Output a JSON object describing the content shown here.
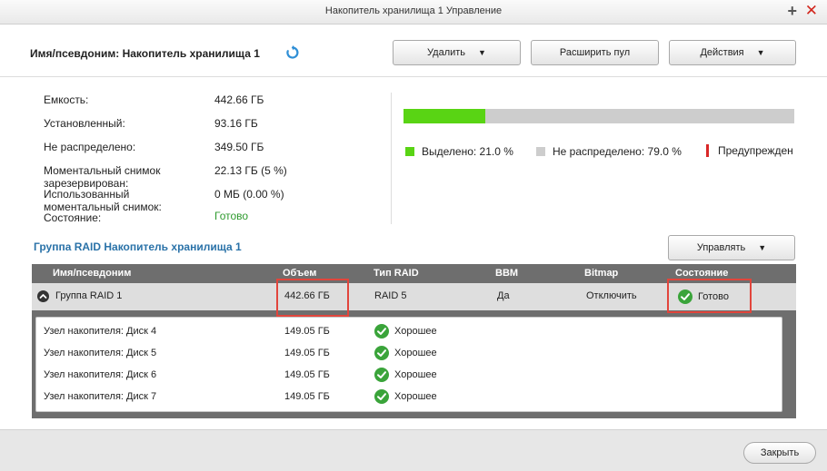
{
  "window": {
    "title": "Накопитель хранилища 1 Управление"
  },
  "header": {
    "alias": "Имя/псевдоним: Накопитель хранилища 1",
    "buttons": {
      "delete": "Удалить",
      "expand": "Расширить пул",
      "actions": "Действия"
    }
  },
  "info": [
    {
      "label": "Емкость:",
      "value": "442.66 ГБ"
    },
    {
      "label": "Установленный:",
      "value": "93.16 ГБ"
    },
    {
      "label": "Не распределено:",
      "value": "349.50 ГБ"
    },
    {
      "label": "Моментальный снимок зарезервирован:",
      "value": "22.13 ГБ (5 %)"
    },
    {
      "label": "Использованный моментальный снимок:",
      "value": "0 МБ (0.00 %)"
    },
    {
      "label": "Состояние:",
      "value": "Готово"
    }
  ],
  "usage": {
    "allocated_percent": 21.0,
    "legend": {
      "allocated": "Выделено: 21.0 %",
      "unallocated": "Не распределено: 79.0 %",
      "warning": "Предупрежден"
    },
    "colors": {
      "allocated": "#59d414",
      "unallocated": "#cdcdcd",
      "warning": "#d92727"
    }
  },
  "raid": {
    "title": "Группа RAID Накопитель хранилища 1",
    "manage_button": "Управлять",
    "columns": {
      "name": "Имя/псевдоним",
      "capacity": "Объем",
      "raid_type": "Тип RAID",
      "bbm": "BBM",
      "bitmap": "Bitmap",
      "status": "Состояние"
    },
    "group": {
      "name": "Группа RAID 1",
      "capacity": "442.66 ГБ",
      "raid_type": "RAID 5",
      "bbm": "Да",
      "bitmap": "Отключить",
      "status": "Готово"
    },
    "disks": [
      {
        "name": "Узел накопителя: Диск 4",
        "capacity": "149.05 ГБ",
        "status": "Хорошее"
      },
      {
        "name": "Узел накопителя: Диск 5",
        "capacity": "149.05 ГБ",
        "status": "Хорошее"
      },
      {
        "name": "Узел накопителя: Диск 6",
        "capacity": "149.05 ГБ",
        "status": "Хорошее"
      },
      {
        "name": "Узел накопителя: Диск 7",
        "capacity": "149.05 ГБ",
        "status": "Хорошее"
      }
    ]
  },
  "footer": {
    "close": "Закрыть"
  }
}
